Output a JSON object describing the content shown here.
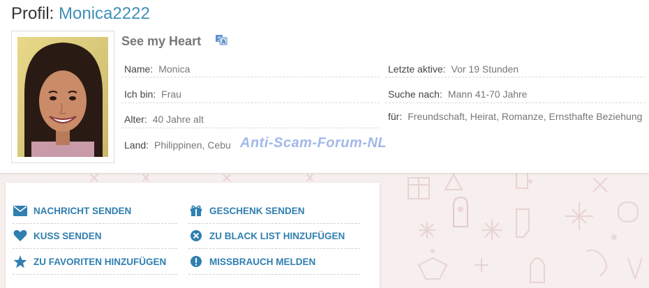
{
  "profile": {
    "title_prefix": "Profil:",
    "username": "Monica2222",
    "motto": "See my Heart",
    "translate_icon": "translate-icon"
  },
  "details": {
    "name_label": "Name:",
    "name_value": "Monica",
    "gender_label": "Ich bin:",
    "gender_value": "Frau",
    "age_label": "Alter:",
    "age_value": "40 Jahre alt",
    "country_label": "Land:",
    "country_value": "Philippinen, Cebu",
    "last_active_label": "Letzte aktive:",
    "last_active_value": "Vor 19 Stunden",
    "seeking_label": "Suche nach:",
    "seeking_value": "Mann 41-70 Jahre",
    "for_label": "für:",
    "for_value": "Freundschaft, Heirat, Romanze, Ernsthafte Beziehung"
  },
  "watermark": "Anti-Scam-Forum-NL",
  "actions": {
    "send_message": "NACHRICHT SENDEN",
    "send_gift": "GESCHENK SENDEN",
    "send_kiss": "KUSS SENDEN",
    "blacklist": "ZU BLACK LIST HINZUFÜGEN",
    "favorites": "ZU FAVORITEN HINZUFÜGEN",
    "report": "MISSBRAUCH MELDEN"
  },
  "colors": {
    "accent": "#3f8fb8",
    "link": "#2f7fb0",
    "background": "#f7eeee"
  }
}
